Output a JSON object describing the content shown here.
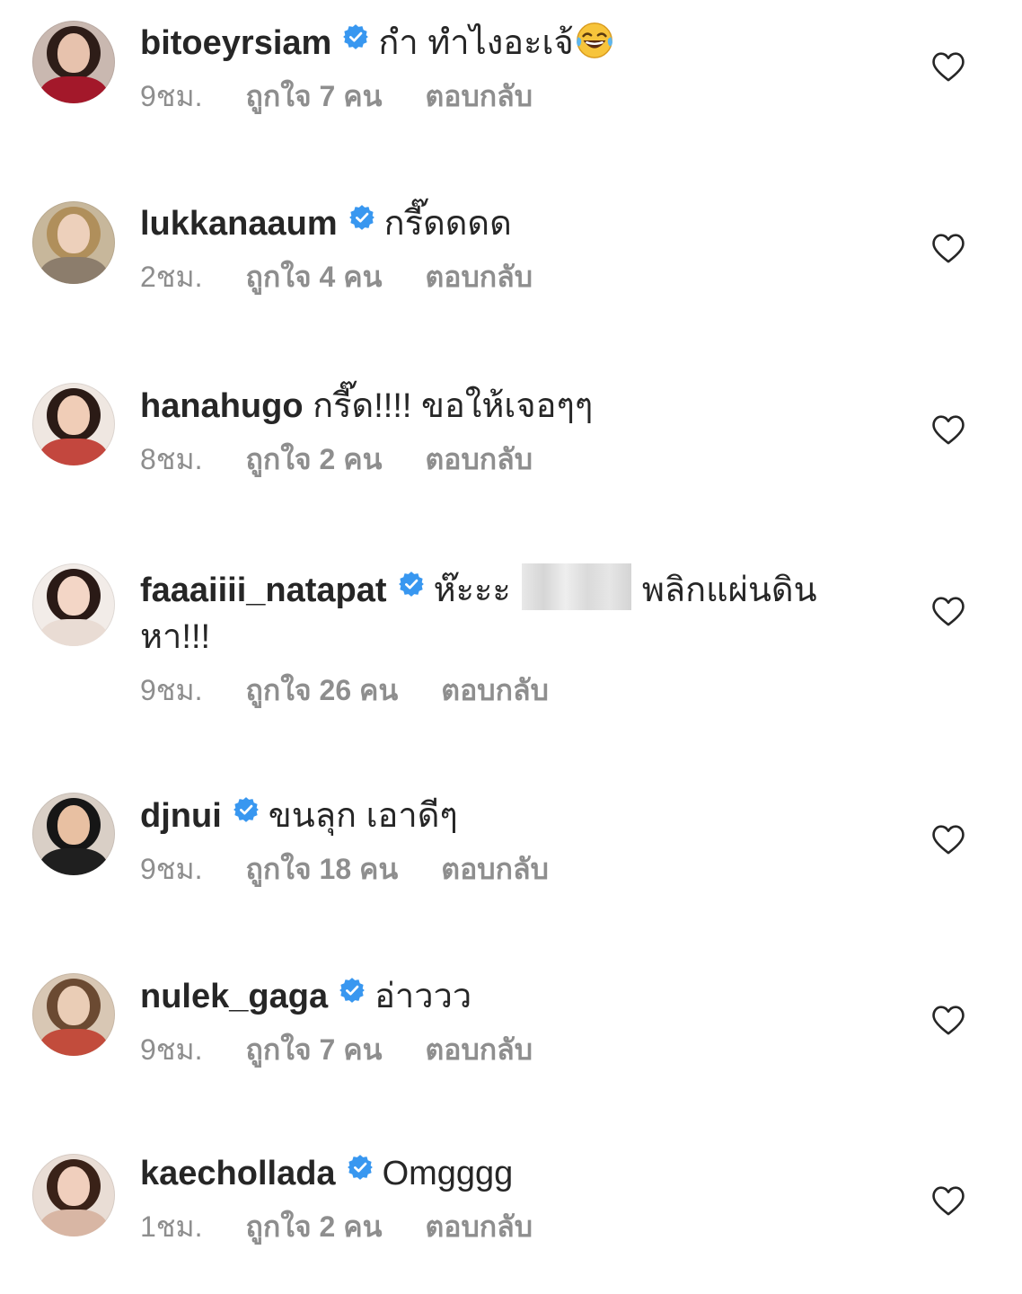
{
  "colors": {
    "text": "#262626",
    "meta": "#8e8e8e",
    "verified": "#3897f0",
    "heart": "#262626"
  },
  "comments": [
    {
      "username": "bitoeyrsiam",
      "verified": true,
      "text": "กำ ทำไงอะเจ้",
      "emoji": "face-with-tears-of-joy",
      "time": "9ชม.",
      "likes": "ถูกใจ 7 คน",
      "reply": "ตอบกลับ"
    },
    {
      "username": "lukkanaaum",
      "verified": true,
      "text": "กรี๊ดดดด",
      "time": "2ชม.",
      "likes": "ถูกใจ 4 คน",
      "reply": "ตอบกลับ"
    },
    {
      "username": "hanahugo",
      "verified": false,
      "text": "กรี๊ด!!!! ขอให้เจอๆๆ",
      "time": "8ชม.",
      "likes": "ถูกใจ 2 คน",
      "reply": "ตอบกลับ"
    },
    {
      "username": "faaaiiii_natapat",
      "verified": true,
      "text_before": "ห๊ะะะ",
      "text_after": "พลิกแผ่นดินหา!!!",
      "time": "9ชม.",
      "likes": "ถูกใจ 26 คน",
      "reply": "ตอบกลับ"
    },
    {
      "username": "djnui",
      "verified": true,
      "text": "ขนลุก เอาดีๆ",
      "time": "9ชม.",
      "likes": "ถูกใจ 18 คน",
      "reply": "ตอบกลับ"
    },
    {
      "username": "nulek_gaga",
      "verified": true,
      "text": "อ่าววว",
      "time": "9ชม.",
      "likes": "ถูกใจ 7 คน",
      "reply": "ตอบกลับ"
    },
    {
      "username": "kaechollada",
      "verified": true,
      "text": "Omgggg",
      "time": "1ชม.",
      "likes": "ถูกใจ 2 คน",
      "reply": "ตอบกลับ"
    }
  ]
}
